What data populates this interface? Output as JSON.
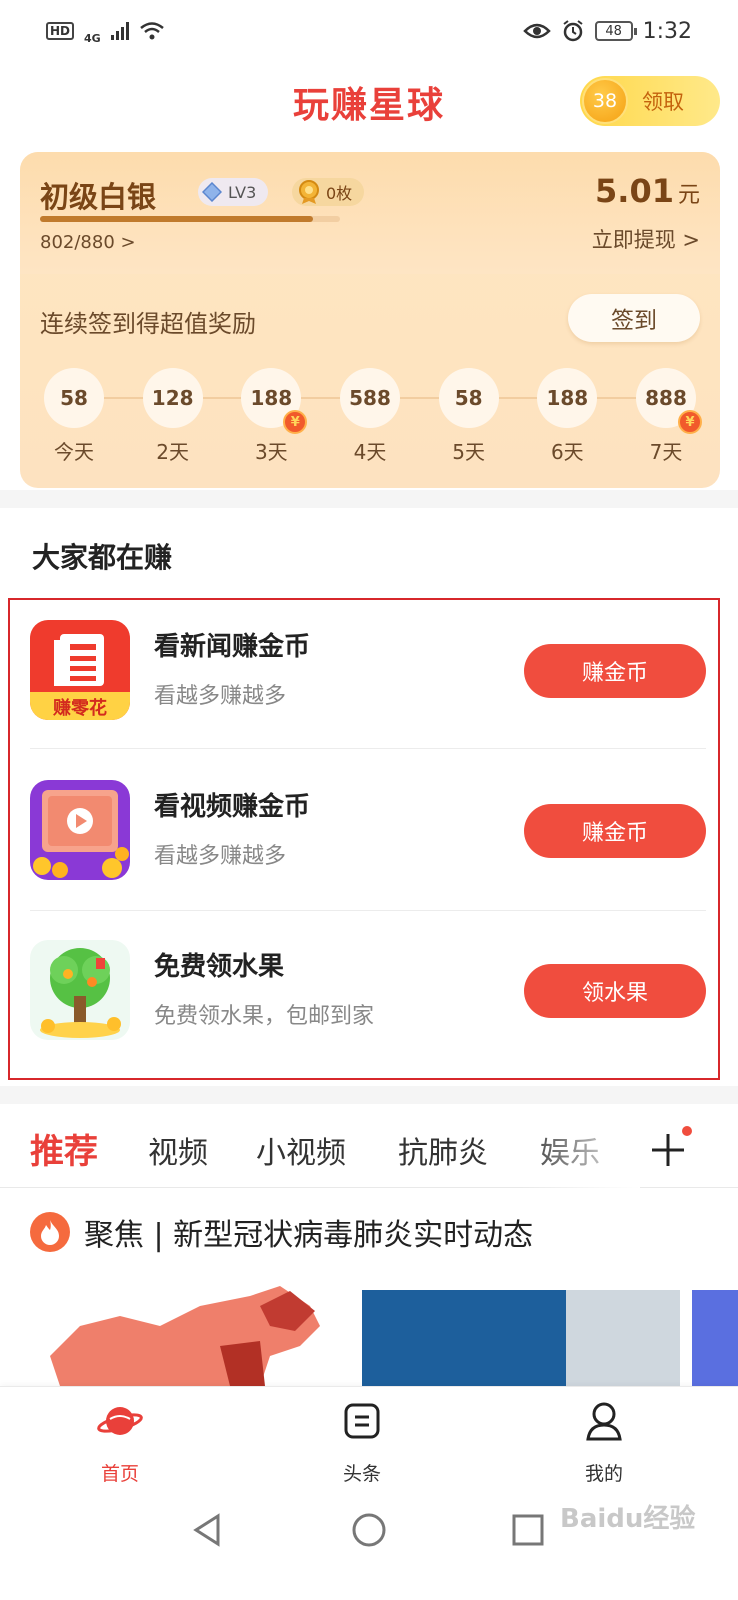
{
  "status_bar": {
    "hd": "HD",
    "network": "4G",
    "battery": "48",
    "time": "1:32"
  },
  "header": {
    "title": "玩赚星球",
    "coin_count": "38",
    "claim_label": "领取"
  },
  "account": {
    "level_name": "初级白银",
    "level_badge": "LV3",
    "medal_count": "0枚",
    "progress_text": "802/880 >",
    "progress_fraction": 0.911,
    "balance": "5.01",
    "balance_unit": "元",
    "withdraw_label": "立即提现 >"
  },
  "checkin": {
    "prompt": "连续签到得超值奖励",
    "button": "签到",
    "days": [
      {
        "amount": "58",
        "label": "今天",
        "bonus": false
      },
      {
        "amount": "128",
        "label": "2天",
        "bonus": false
      },
      {
        "amount": "188",
        "label": "3天",
        "bonus": true
      },
      {
        "amount": "588",
        "label": "4天",
        "bonus": false
      },
      {
        "amount": "58",
        "label": "5天",
        "bonus": false
      },
      {
        "amount": "188",
        "label": "6天",
        "bonus": false
      },
      {
        "amount": "888",
        "label": "7天",
        "bonus": true
      }
    ],
    "bonus_symbol": "¥"
  },
  "earn_section": {
    "title": "大家都在赚",
    "tasks": [
      {
        "title": "看新闻赚金币",
        "subtitle": "看越多赚越多",
        "button": "赚金币",
        "icon_caption": "赚零花",
        "icon": "news-app-icon"
      },
      {
        "title": "看视频赚金币",
        "subtitle": "看越多赚越多",
        "button": "赚金币",
        "icon": "video-app-icon"
      },
      {
        "title": "免费领水果",
        "subtitle": "免费领水果，包邮到家",
        "button": "领水果",
        "icon": "fruit-tree-app-icon"
      }
    ]
  },
  "news_tabs": {
    "tabs": [
      "推荐",
      "视频",
      "小视频",
      "抗肺炎",
      "娱乐"
    ],
    "active": 0
  },
  "focus": {
    "text": "聚焦 | 新型冠状病毒肺炎实时动态"
  },
  "bottom_nav": {
    "items": [
      {
        "label": "首页",
        "icon": "planet-icon"
      },
      {
        "label": "头条",
        "icon": "headline-icon"
      },
      {
        "label": "我的",
        "icon": "profile-icon"
      }
    ]
  },
  "watermark": "Baidu经验",
  "colors": {
    "brand_red": "#e9403a",
    "button_red": "#f04d3e",
    "card_bg": "#fde2c0",
    "highlight_border": "#d7272b"
  }
}
